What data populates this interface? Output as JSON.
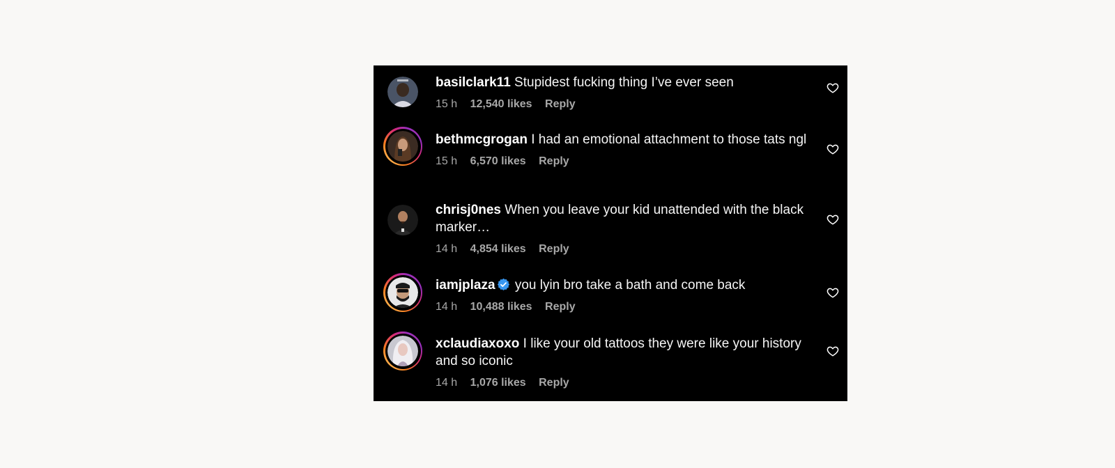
{
  "comments": [
    {
      "username": "basilclark11",
      "verified": false,
      "text": "Stupidest fucking thing I’ve ever seen",
      "time": "15 h",
      "likes": "12,540 likes",
      "reply": "Reply",
      "story_ring": false
    },
    {
      "username": "bethmcgrogan",
      "verified": false,
      "text": "I had an emotional attachment to those tats ngl",
      "time": "15 h",
      "likes": "6,570 likes",
      "reply": "Reply",
      "story_ring": true
    },
    {
      "username": "chrisj0nes",
      "verified": false,
      "text": "When you leave your kid unattended with the black marker…",
      "time": "14 h",
      "likes": "4,854 likes",
      "reply": "Reply",
      "story_ring": false
    },
    {
      "username": "iamjplaza",
      "verified": true,
      "text": "you lyin bro take a bath and come back",
      "time": "14 h",
      "likes": "10,488 likes",
      "reply": "Reply",
      "story_ring": true
    },
    {
      "username": "xclaudiaxoxo",
      "verified": false,
      "text": "I like your old tattoos they were like your history and so iconic",
      "time": "14 h",
      "likes": "1,076 likes",
      "reply": "Reply",
      "story_ring": true
    }
  ],
  "colors": {
    "panel_bg": "#000000",
    "page_bg": "#f9f8f6",
    "meta_text": "#a8a8a8",
    "verified_badge": "#3897f0"
  },
  "icons": {
    "like": "heart-outline-icon",
    "verified": "verified-badge-icon"
  }
}
